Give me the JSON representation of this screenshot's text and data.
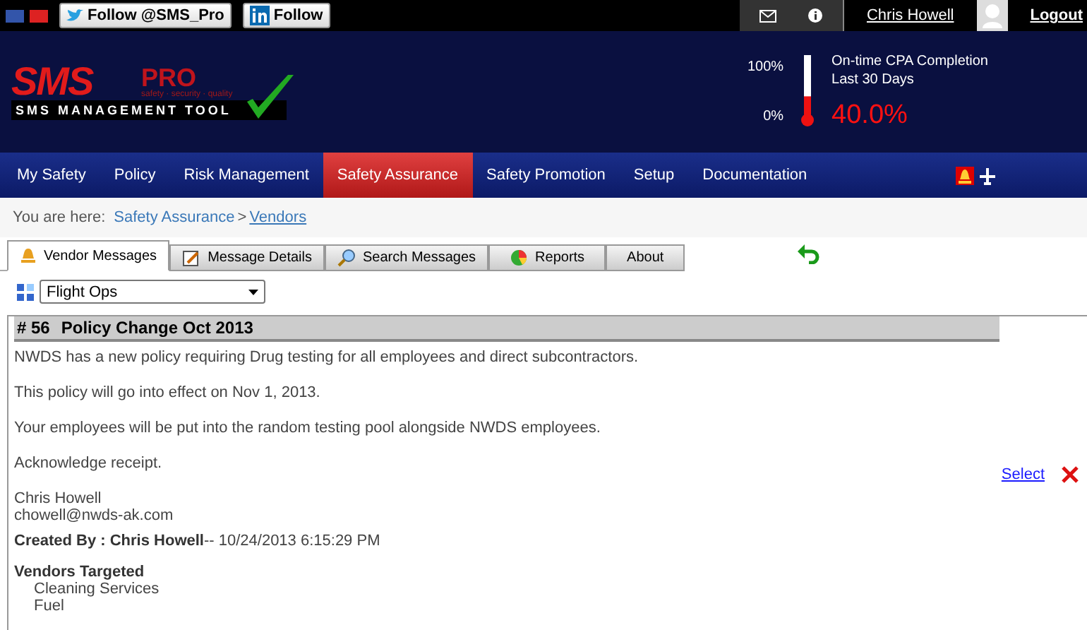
{
  "topbar": {
    "social": [
      {
        "kind": "twitter",
        "label": "Follow @SMS_Pro"
      },
      {
        "kind": "linkedin",
        "label": "Follow"
      }
    ],
    "user": "Chris Howell",
    "logout": "Logout"
  },
  "logo": {
    "main": "SMS",
    "pro": "PRO",
    "tagline": "safety · security · quality",
    "subtitle": "SMS MANAGEMENT TOOL"
  },
  "meter": {
    "top_label": "100%",
    "bottom_label": "0%",
    "level": 0.4,
    "title": "On-time CPA Completion",
    "period": "Last 30 Days",
    "value": "40.0%"
  },
  "nav": [
    {
      "label": "My Safety",
      "selected": false
    },
    {
      "label": "Policy",
      "selected": false
    },
    {
      "label": "Risk Management",
      "selected": false
    },
    {
      "label": "Safety Assurance",
      "selected": true
    },
    {
      "label": "Safety Promotion",
      "selected": false
    },
    {
      "label": "Setup",
      "selected": false
    },
    {
      "label": "Documentation",
      "selected": false
    }
  ],
  "breadcrumb": {
    "prefix": "You are here:",
    "parent": "Safety Assurance",
    "separator": ">",
    "current": "Vendors"
  },
  "tabs": [
    {
      "label": "Vendor Messages",
      "kind": "bell",
      "selected": true
    },
    {
      "label": "Message Details",
      "kind": "note",
      "selected": false
    },
    {
      "label": "Search Messages",
      "kind": "search",
      "selected": false
    },
    {
      "label": "Reports",
      "kind": "chart",
      "selected": false
    },
    {
      "label": "About",
      "kind": "none",
      "selected": false
    }
  ],
  "filter": {
    "value": "Flight Ops"
  },
  "message": {
    "number": "# 56",
    "title": "Policy Change Oct 2013",
    "paragraphs": [
      "NWDS has a new policy requiring Drug testing for all employees and direct subcontractors.",
      "This policy will go into effect on Nov 1, 2013.",
      "Your employees will be put into the random testing pool alongside NWDS employees.",
      "Acknowledge receipt."
    ],
    "signature": [
      "Chris Howell",
      "chowell@nwds-ak.com"
    ],
    "created_label": "Created By : Chris Howell",
    "created_at": "-- 10/24/2013 6:15:29 PM",
    "select": "Select",
    "vendors_heading": "Vendors Targeted",
    "vendors": [
      "Cleaning Services",
      "Fuel"
    ]
  }
}
